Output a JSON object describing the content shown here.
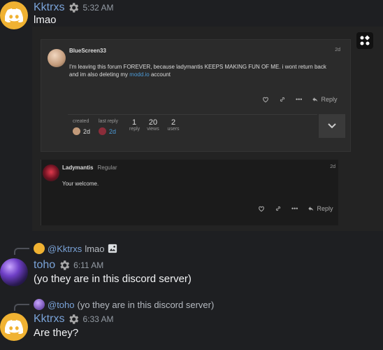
{
  "messages": [
    {
      "user": "Kktrxs",
      "time": "5:32 AM",
      "text": "lmao"
    },
    {
      "reply_to_user": "@Kktrxs",
      "reply_to_text": "lmao",
      "user": "toho",
      "time": "6:11 AM",
      "text": "(yo they are in this discord server)"
    },
    {
      "reply_to_user": "@toho",
      "reply_to_text": "(yo they are in this discord server)",
      "user": "Kktrxs",
      "time": "6:33 AM",
      "text": "Are they?"
    }
  ],
  "embed": {
    "post": {
      "author": "BlueScreen33",
      "age": "2d",
      "body_before": "I'm leaving this forum FOREVER, because ladymantis KEEPS MAKING FUN OF ME. i wont return back and im also deleting my",
      "link": "modd.io",
      "body_after": "account",
      "reply_label": "Reply",
      "more_label": "•••",
      "stats": {
        "created_label": "created",
        "created_value": "2d",
        "last_reply_label": "last reply",
        "last_reply_value": "2d",
        "replies_value": "1",
        "replies_label": "reply",
        "views_value": "20",
        "views_label": "views",
        "users_value": "2",
        "users_label": "users"
      }
    },
    "reply": {
      "author": "Ladymantis",
      "role": "Regular",
      "age": "2d",
      "body": "Your welcome.",
      "reply_label": "Reply",
      "more_label": "•••"
    }
  },
  "colors": {
    "username": "#7aa3d8",
    "link": "#4c9bd8",
    "discord_yellow": "#f0b232"
  }
}
